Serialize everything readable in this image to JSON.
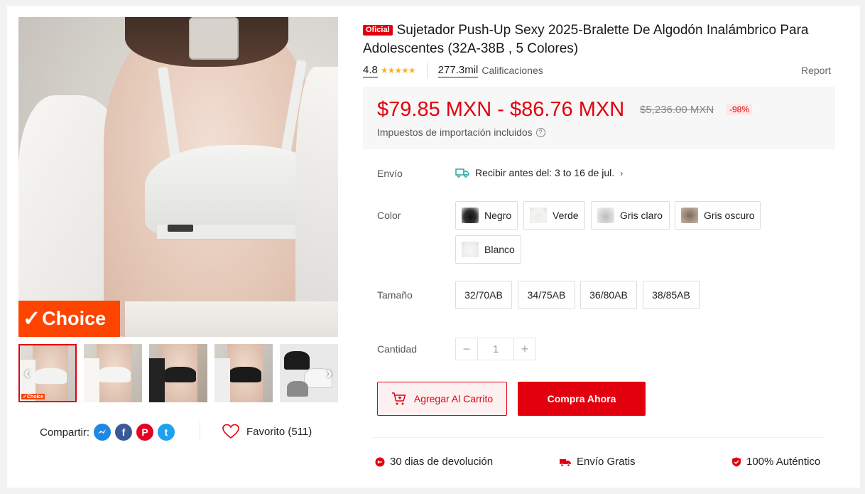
{
  "product": {
    "badge": "Oficial",
    "title": "Sujetador Push-Up Sexy 2025-Bralette De Algodón Inalámbrico Para Adolescentes (32A-38B , 5 Colores)",
    "rating": "4.8",
    "stars": "★★★★★",
    "ratings_count": "277.3mil",
    "ratings_label": "Calificaciones",
    "report": "Report"
  },
  "gallery": {
    "choice_badge": "Choice",
    "choice_check": "✓",
    "mini_choice": "✓Choice",
    "prev_arrow": "‹",
    "next_arrow": "›",
    "thumbnails": [
      "thumb-1",
      "thumb-2",
      "thumb-3",
      "thumb-4",
      "thumb-5"
    ]
  },
  "share": {
    "label": "Compartir:",
    "networks": [
      "messenger-icon",
      "facebook-icon",
      "pinterest-icon",
      "twitter-icon"
    ],
    "facebook_glyph": "f",
    "pinterest_glyph": "P",
    "twitter_glyph": "t",
    "messenger_glyph": "~"
  },
  "favorite": {
    "label": "Favorito (511)"
  },
  "price": {
    "range": "$79.85 MXN - $86.76 MXN",
    "original": "$5,236.00 MXN",
    "discount": "-98%",
    "tax_note": "Impuestos de importación incluidos",
    "tax_help": "?"
  },
  "shipping": {
    "label": "Envío",
    "text": "Recibir antes del: 3 to 16 de jul.",
    "chevron": "›"
  },
  "color": {
    "label": "Color",
    "options": [
      "Negro",
      "Verde",
      "Gris claro",
      "Gris oscuro",
      "Blanco"
    ]
  },
  "size": {
    "label": "Tamaño",
    "options": [
      "32/70AB",
      "34/75AB",
      "36/80AB",
      "38/85AB"
    ]
  },
  "quantity": {
    "label": "Cantidad",
    "value": "1",
    "minus": "−",
    "plus": "+"
  },
  "actions": {
    "add_to_cart": "Agregar Al Carrito",
    "buy_now": "Compra Ahora"
  },
  "assurances": [
    "30 dias de devolución",
    "Envío Gratis",
    "100% Auténtico"
  ],
  "colors": {
    "accent": "#e3000e",
    "choice": "#fd4400",
    "stars": "#fdb022"
  }
}
